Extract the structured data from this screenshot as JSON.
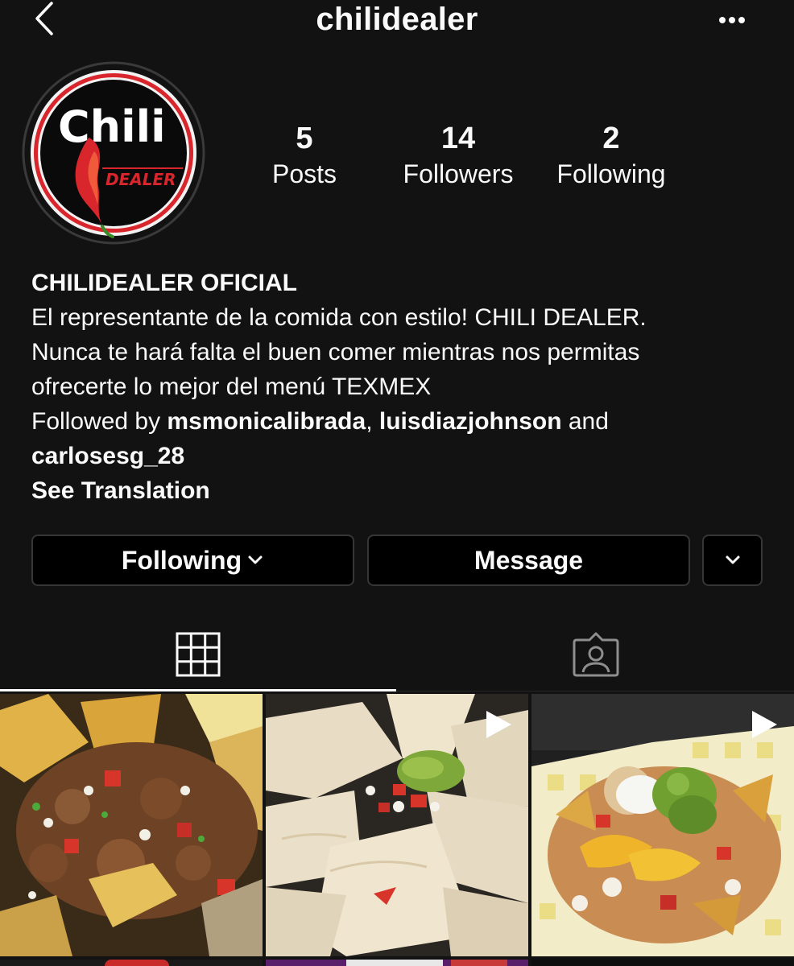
{
  "header": {
    "username": "chilidealer"
  },
  "profile": {
    "avatar_text_main": "Chili",
    "avatar_text_sub": "DEALER",
    "stats": [
      {
        "value": "5",
        "label": "Posts"
      },
      {
        "value": "14",
        "label": "Followers"
      },
      {
        "value": "2",
        "label": "Following"
      }
    ],
    "display_name": "CHILIDEALER OFICIAL",
    "bio_lines": [
      "El representante de la comida con estilo! CHILI DEALER.",
      "Nunca te hará falta el buen comer mientras nos permitas",
      "ofrecerte lo mejor del menú TEXMEX"
    ],
    "followed_by_prefix": "Followed by ",
    "followed_by_users": [
      "msmonicalibrada",
      "luisdiazjohnson",
      "carlosesg_28"
    ],
    "followed_by_sep": ", ",
    "followed_by_and": " and",
    "see_translation": "See Translation"
  },
  "actions": {
    "following_label": "Following",
    "message_label": "Message"
  },
  "tabs": {
    "active": "grid",
    "items": [
      "grid-icon",
      "tagged-icon"
    ]
  },
  "posts": [
    {
      "type": "image",
      "subject": "nachos"
    },
    {
      "type": "video",
      "subject": "quesadillas"
    },
    {
      "type": "video",
      "subject": "nachos supreme"
    }
  ],
  "colors": {
    "background": "#121212",
    "button_bg": "#000000",
    "button_border": "#363636",
    "brand_red": "#d8262c"
  }
}
